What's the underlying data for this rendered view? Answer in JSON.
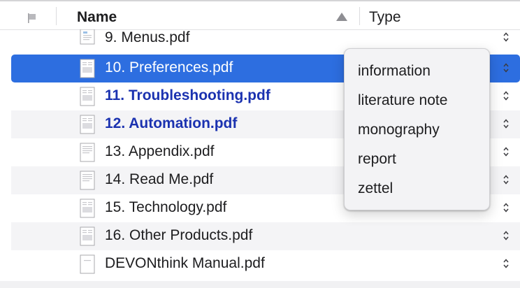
{
  "header": {
    "name_label": "Name",
    "type_label": "Type"
  },
  "files": [
    {
      "name": "9. Menus.pdf",
      "style": "normal"
    },
    {
      "name": "10. Preferences.pdf",
      "style": "selected"
    },
    {
      "name": "11. Troubleshooting.pdf",
      "style": "bold"
    },
    {
      "name": "12. Automation.pdf",
      "style": "bold"
    },
    {
      "name": "13. Appendix.pdf",
      "style": "normal"
    },
    {
      "name": "14. Read Me.pdf",
      "style": "normal"
    },
    {
      "name": "15. Technology.pdf",
      "style": "normal"
    },
    {
      "name": "16. Other Products.pdf",
      "style": "normal"
    },
    {
      "name": "DEVONthink Manual.pdf",
      "style": "normal"
    }
  ],
  "type_menu": {
    "options": [
      "information",
      "literature note",
      "monography",
      "report",
      "zettel"
    ]
  },
  "colors": {
    "selection": "#2d6ee0",
    "unread_text": "#1b32b0",
    "stripe": "#f4f4f6"
  }
}
